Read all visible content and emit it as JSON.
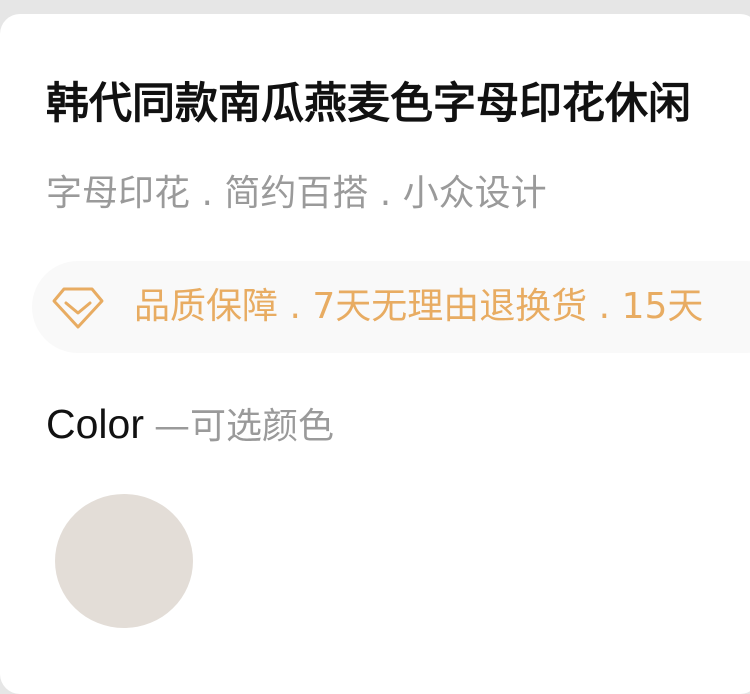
{
  "product": {
    "title": "韩代同款南瓜燕麦色字母印花休闲",
    "subtitle": "字母印花 . 简约百搭 . 小众设计"
  },
  "guarantee": {
    "icon": "diamond-icon",
    "text": "品质保障 . 7天无理由退换货 . 15天",
    "color": "#e8ac62"
  },
  "color_section": {
    "label": "Color",
    "sublabel": "—可选颜色",
    "swatches": [
      {
        "color": "#e3ddd7"
      }
    ]
  }
}
